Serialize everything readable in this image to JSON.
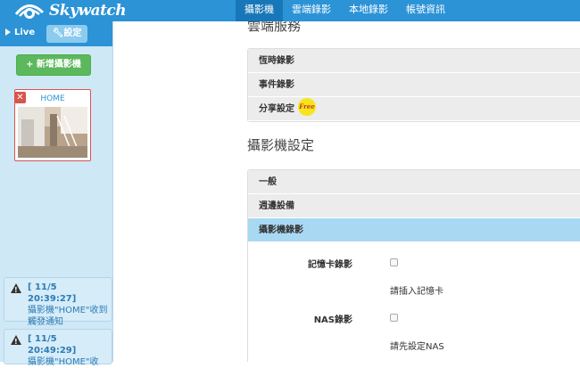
{
  "brand": {
    "name": "Skywatch"
  },
  "nav": {
    "items": [
      {
        "label": "攝影機",
        "active": true
      },
      {
        "label": "雲端錄影",
        "active": false
      },
      {
        "label": "本地錄影",
        "active": false
      },
      {
        "label": "帳號資訊",
        "active": false
      }
    ]
  },
  "sidebar": {
    "live_label": "Live",
    "settings_label": "設定",
    "add_camera_label": "+ 新增攝影機",
    "camera": {
      "name": "HOME"
    },
    "alerts": [
      {
        "time": "[ 11/5 20:39:27]",
        "message": "攝影機\"HOME\"收到觸發通知"
      },
      {
        "time": "[ 11/5 20:49:29]",
        "message": "攝影機\"HOME\"收"
      }
    ]
  },
  "main": {
    "cloud_heading": "雲端服務",
    "cloud_rows": [
      {
        "label": "恆時錄影"
      },
      {
        "label": "事件錄影"
      },
      {
        "label": "分享設定",
        "badge": "Free"
      }
    ],
    "camera_settings_heading": "攝影機設定",
    "settings_rows": [
      {
        "label": "一般",
        "active": false
      },
      {
        "label": "週邊設備",
        "active": false
      },
      {
        "label": "攝影機錄影",
        "active": true
      }
    ],
    "sd_label": "記憶卡錄影",
    "sd_hint": "請插入記憶卡",
    "nas_label": "NAS錄影",
    "nas_hint": "請先設定NAS"
  },
  "colors": {
    "primary": "#2b93d6",
    "success": "#5cb85c",
    "danger": "#d9534f",
    "active_row": "#a9d8f3"
  }
}
